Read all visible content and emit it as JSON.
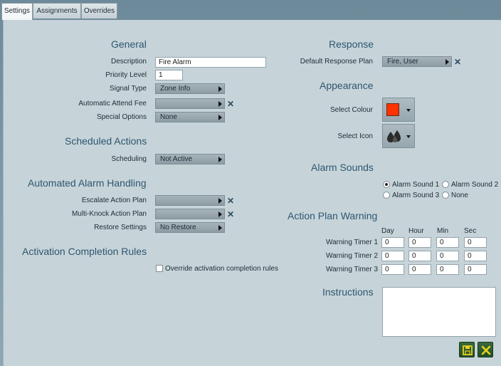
{
  "tabs": [
    {
      "label": "Settings",
      "active": true
    },
    {
      "label": "Assignments",
      "active": false
    },
    {
      "label": "Overrides",
      "active": false
    }
  ],
  "general": {
    "title": "General",
    "description_label": "Description",
    "description_value": "Fire Alarm",
    "priority_label": "Priority Level",
    "priority_value": "1",
    "signal_type_label": "Signal Type",
    "signal_type_value": "Zone Info",
    "attend_fee_label": "Automatic Attend Fee",
    "attend_fee_value": "",
    "special_options_label": "Special Options",
    "special_options_value": "None"
  },
  "scheduled": {
    "title": "Scheduled Actions",
    "scheduling_label": "Scheduling",
    "scheduling_value": "Not Active"
  },
  "automated": {
    "title": "Automated Alarm Handling",
    "escalate_label": "Escalate Action Plan",
    "escalate_value": "",
    "multiknock_label": "Multi-Knock Action Plan",
    "multiknock_value": "",
    "restore_label": "Restore Settings",
    "restore_value": "No Restore"
  },
  "activation": {
    "title": "Activation Completion Rules",
    "override_label": "Override activation completion rules",
    "override_checked": false
  },
  "response": {
    "title": "Response",
    "plan_label": "Default Response Plan",
    "plan_value": "Fire, User"
  },
  "appearance": {
    "title": "Appearance",
    "colour_label": "Select Colour",
    "colour_value": "#ff3300",
    "icon_label": "Select Icon",
    "icon_name": "fire-drops-icon"
  },
  "alarm_sounds": {
    "title": "Alarm Sounds",
    "options": [
      "Alarm Sound 1",
      "Alarm Sound 2",
      "Alarm Sound 3",
      "None"
    ],
    "selected": "Alarm Sound 1"
  },
  "action_plan_warning": {
    "title": "Action Plan Warning",
    "columns": [
      "Day",
      "Hour",
      "Min",
      "Sec"
    ],
    "rows": [
      {
        "label": "Warning Timer 1",
        "values": [
          "0",
          "0",
          "0",
          "0"
        ]
      },
      {
        "label": "Warning Timer 2",
        "values": [
          "0",
          "0",
          "0",
          "0"
        ]
      },
      {
        "label": "Warning Timer 3",
        "values": [
          "0",
          "0",
          "0",
          "0"
        ]
      }
    ]
  },
  "instructions": {
    "title": "Instructions",
    "value": ""
  },
  "colors": {
    "panel_bg": "#c6d4d9",
    "section_title": "#2e5670",
    "action_green": "#2f5e32"
  }
}
